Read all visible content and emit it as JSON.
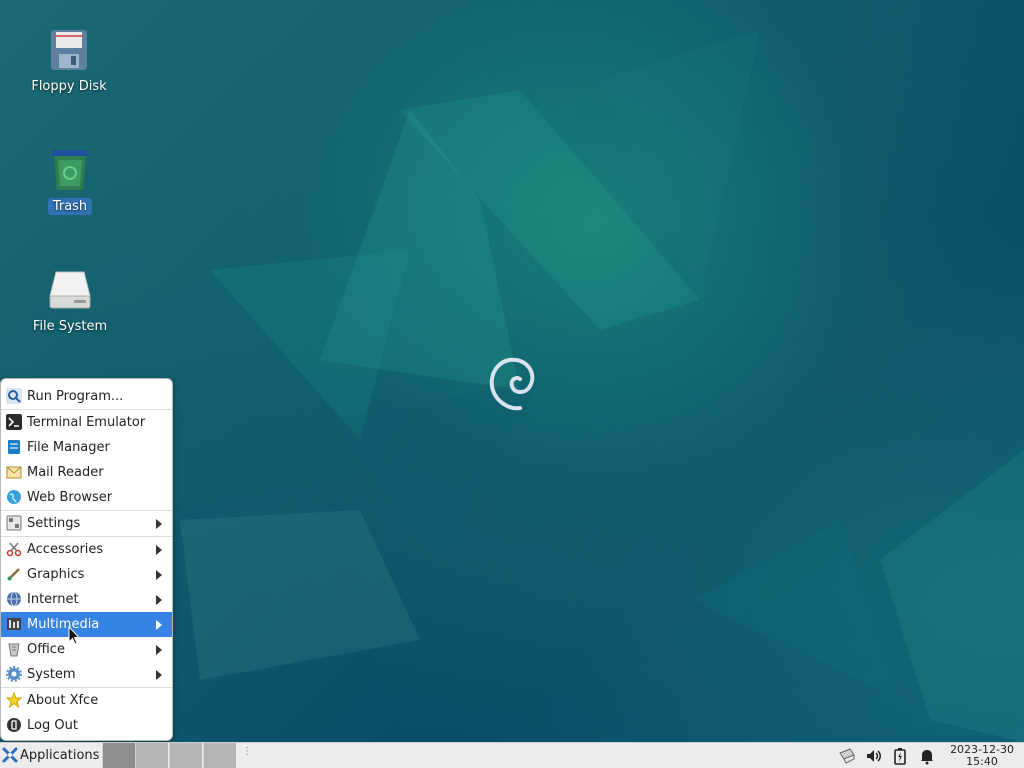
{
  "desktop": {
    "icons": [
      {
        "label": "Floppy Disk",
        "icon": "floppy-disk-icon"
      },
      {
        "label": "Trash",
        "icon": "trash-icon",
        "selected": true
      },
      {
        "label": "File System",
        "icon": "hard-drive-icon"
      }
    ]
  },
  "menu": {
    "items": [
      {
        "label": "Run Program...",
        "icon": "search-icon"
      },
      {
        "label": "Terminal Emulator",
        "icon": "terminal-icon"
      },
      {
        "label": "File Manager",
        "icon": "folder-icon"
      },
      {
        "label": "Mail Reader",
        "icon": "mail-icon"
      },
      {
        "label": "Web Browser",
        "icon": "globe-icon"
      },
      {
        "label": "Settings",
        "icon": "settings-icon",
        "submenu": true
      },
      {
        "label": "Accessories",
        "icon": "scissors-icon",
        "submenu": true
      },
      {
        "label": "Graphics",
        "icon": "brush-icon",
        "submenu": true
      },
      {
        "label": "Internet",
        "icon": "internet-icon",
        "submenu": true
      },
      {
        "label": "Multimedia",
        "icon": "multimedia-icon",
        "submenu": true,
        "active": true
      },
      {
        "label": "Office",
        "icon": "office-icon",
        "submenu": true
      },
      {
        "label": "System",
        "icon": "gear-icon",
        "submenu": true
      },
      {
        "label": "About Xfce",
        "icon": "star-icon"
      },
      {
        "label": "Log Out",
        "icon": "logout-icon"
      }
    ]
  },
  "panel": {
    "applications_label": "Applications",
    "workspaces": 4,
    "clock": {
      "date": "2023-12-30",
      "time": "15:40"
    },
    "tray_icons": [
      "network-icon",
      "volume-icon",
      "battery-icon",
      "notification-bell-icon"
    ]
  },
  "colors": {
    "selection": "#3584e4",
    "desktop_selection": "#2f73b7",
    "panel_bg": "#ececec"
  }
}
